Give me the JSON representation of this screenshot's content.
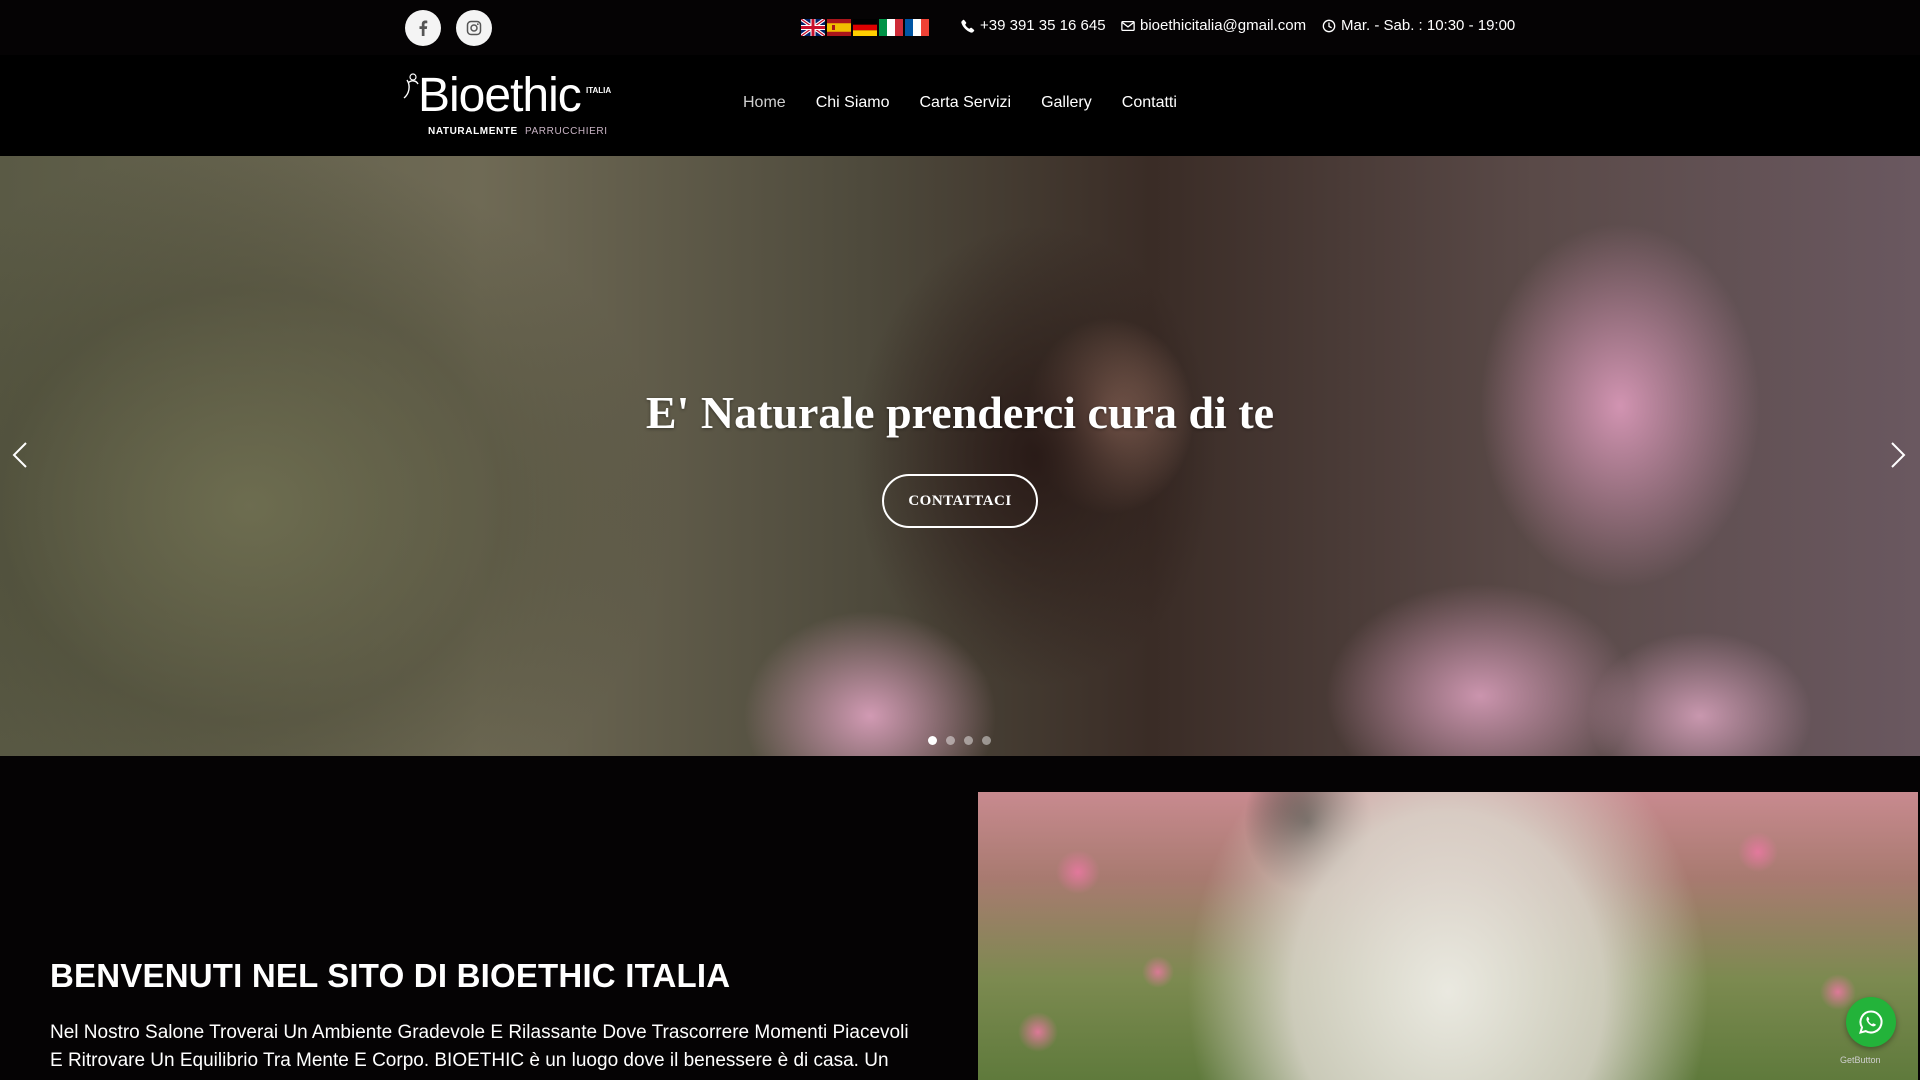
{
  "topbar": {
    "phone": "+39 391 35 16 645",
    "email": "bioethicitalia@gmail.com",
    "hours": "Mar. - Sab. : 10:30 - 19:00",
    "socials": [
      "facebook-icon",
      "instagram-icon"
    ],
    "flags": [
      "flag-uk",
      "flag-spain",
      "flag-germany",
      "flag-italy",
      "flag-france"
    ]
  },
  "logo": {
    "brand": "Bioethic",
    "tag": "ITALIA",
    "sub_a": "NATURALMENTE",
    "sub_b": "PARRUCCHIERI"
  },
  "nav": {
    "items": [
      {
        "label": "Home",
        "active": true
      },
      {
        "label": "Chi Siamo"
      },
      {
        "label": "Carta Servizi"
      },
      {
        "label": "Gallery"
      },
      {
        "label": "Contatti"
      }
    ]
  },
  "hero": {
    "title": "E' Naturale prenderci cura di te",
    "button": "CONTATTACI",
    "slides": 4,
    "active_slide": 1
  },
  "welcome": {
    "title": "BENVENUTI NEL SITO DI BIOETHIC ITALIA",
    "text": "Nel Nostro Salone Troverai Un Ambiente Gradevole E Rilassante Dove Trascorrere Momenti Piacevoli E Ritrovare Un Equilibrio Tra Mente E Corpo. BIOETHIC è un luogo dove il benessere è di casa. Un"
  },
  "widget": {
    "getbutton": "GetButton"
  },
  "colors": {
    "background": "#050304",
    "whatsapp": "#23b33a"
  }
}
